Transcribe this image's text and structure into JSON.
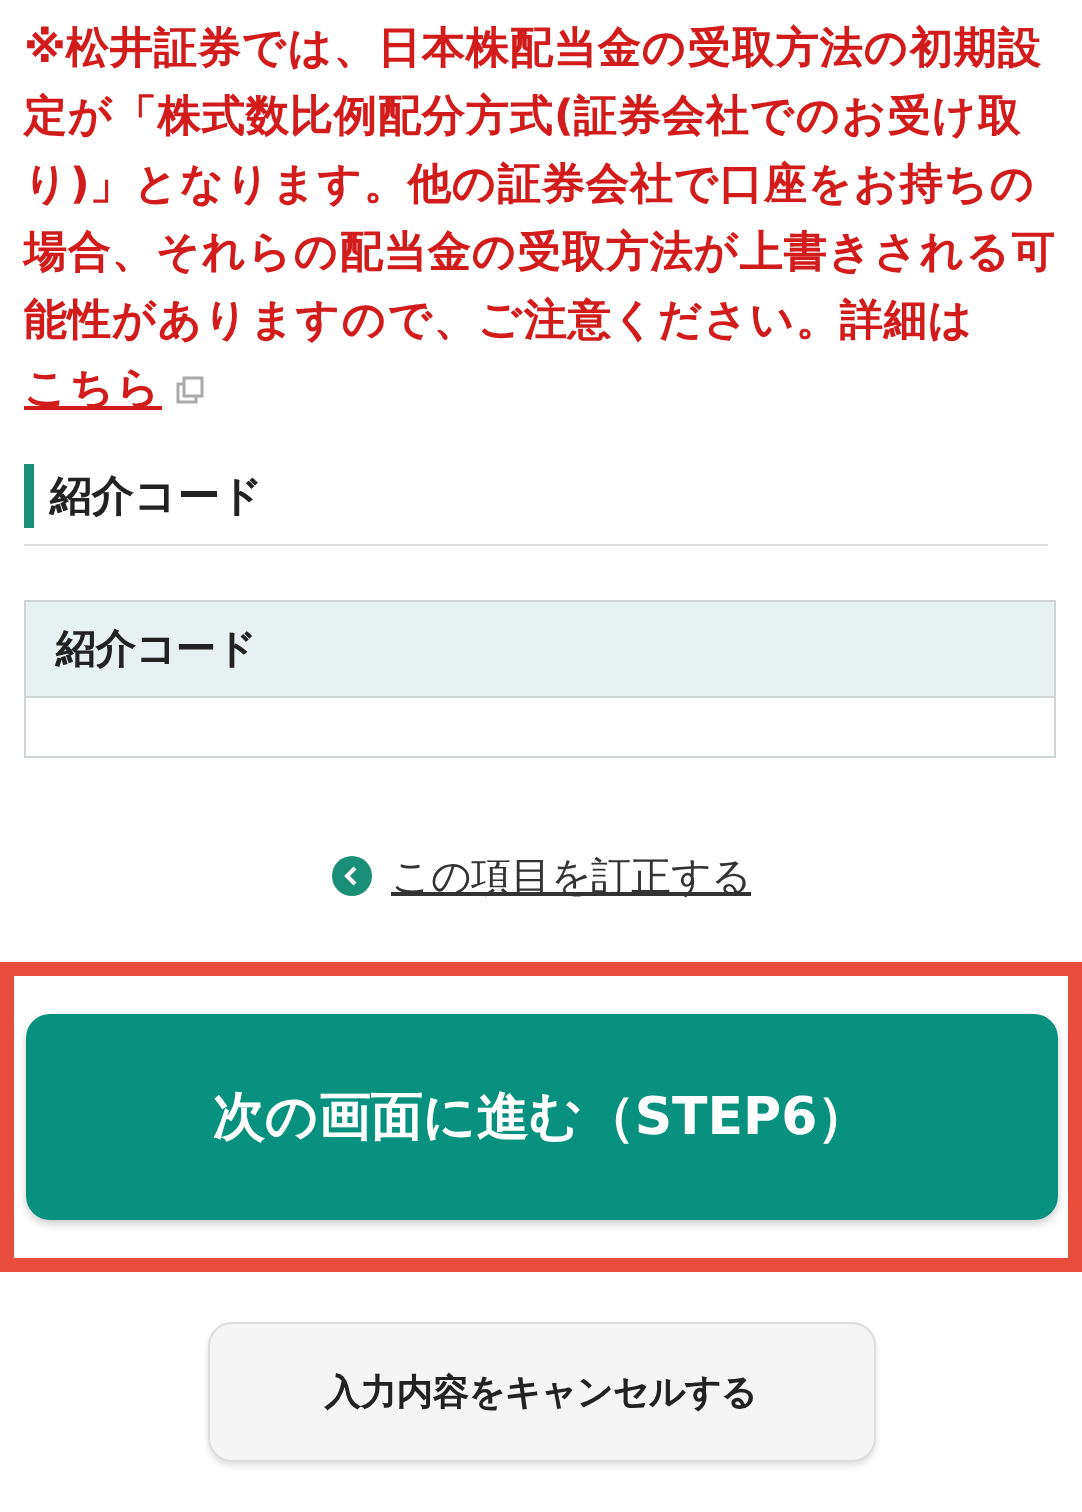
{
  "notice": {
    "text": "※松井証券では、日本株配当金の受取方法の初期設定が「株式数比例配分方式(証券会社でのお受け取り)」となります。他の証券会社で口座をお持ちの場合、それらの配当金の受取方法が上書きされる可能性がありますので、ご注意ください。詳細は",
    "link": "こちら"
  },
  "section": {
    "title": "紹介コード"
  },
  "table": {
    "header": "紹介コード"
  },
  "correct_link": {
    "label": "この項目を訂正する"
  },
  "buttons": [
    {
      "kind": "primary",
      "label": "次の画面に進む（STEP6）",
      "highlighted": true
    },
    {
      "kind": "secondary",
      "label": "入力内容をキャンセルする",
      "highlighted": false
    }
  ]
}
